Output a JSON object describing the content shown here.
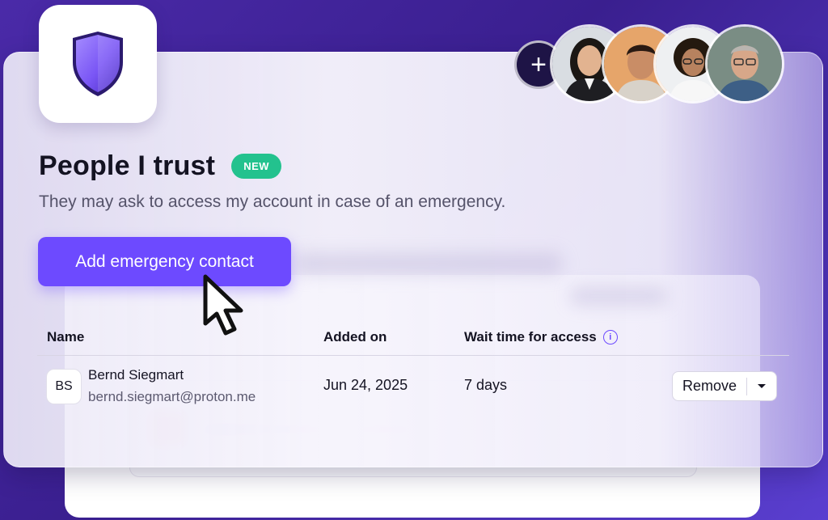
{
  "header": {
    "title": "People I trust",
    "badge": "NEW",
    "subtitle": "They may ask to access my account in case of an emergency."
  },
  "actions": {
    "add_contact_label": "Add emergency contact",
    "add_people_icon": "plus-icon"
  },
  "avatars": [
    {
      "icon": "avatar-woman-1"
    },
    {
      "icon": "avatar-man-1"
    },
    {
      "icon": "avatar-woman-2"
    },
    {
      "icon": "avatar-man-2"
    }
  ],
  "table": {
    "columns": [
      "Name",
      "Added on",
      "Wait time for access"
    ],
    "info_icon": "i",
    "rows": [
      {
        "initials": "BS",
        "name": "Bernd Siegmart",
        "email": "bernd.siegmart@proton.me",
        "added_on": "Jun 24, 2025",
        "wait_time": "7 days",
        "action_label": "Remove"
      }
    ]
  },
  "colors": {
    "accent": "#6d4aff",
    "badge": "#23c28e",
    "background": "#3a1f8f"
  }
}
